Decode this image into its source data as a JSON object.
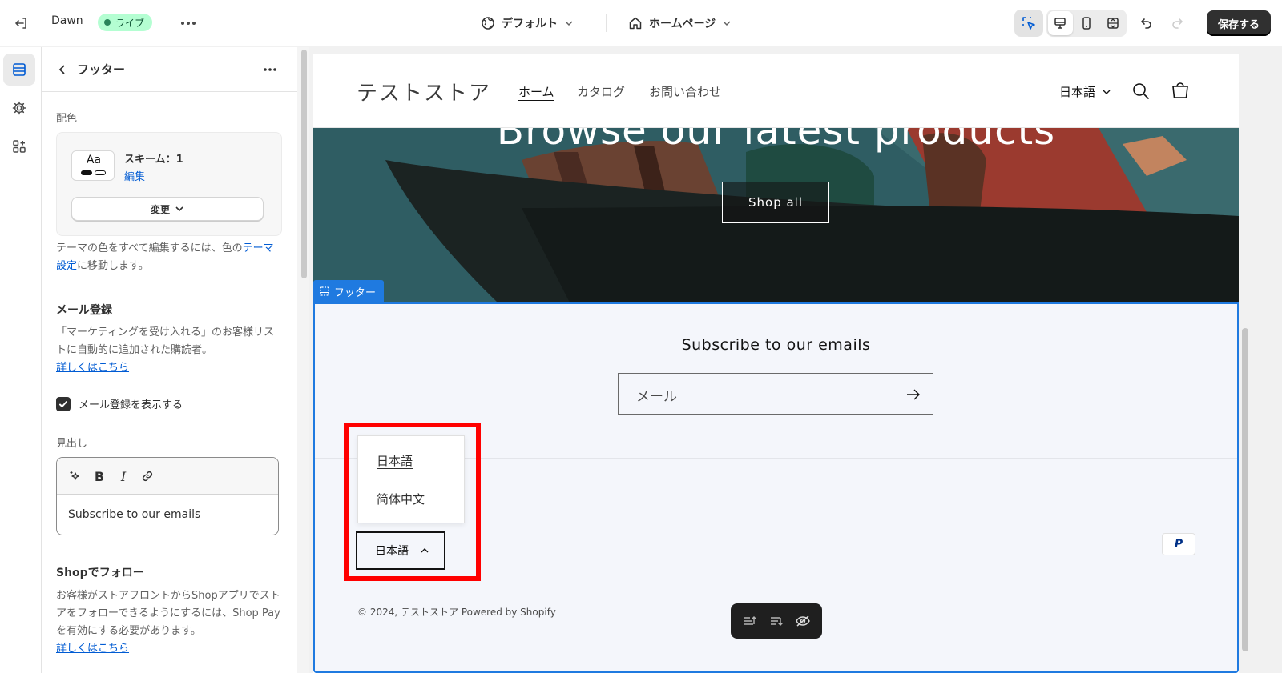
{
  "topbar": {
    "theme_name": "Dawn",
    "status_badge": "ライブ",
    "preset_label": "デフォルト",
    "page_label": "ホームページ",
    "save_label": "保存する"
  },
  "panel": {
    "title": "フッター",
    "color_section_label": "配色",
    "scheme": {
      "swatch_text": "Aa",
      "name": "スキーム：1",
      "edit_label": "編集",
      "change_label": "変更"
    },
    "color_help_prefix": "テーマの色をすべて編集するには、色の",
    "color_help_link": "テーマ設定",
    "color_help_suffix": "に移動します。",
    "email_section_title": "メール登録",
    "email_help": "「マーケティングを受け入れる」のお客様リストに自動的に追加された購読者。",
    "email_help_link": "詳しくはこちら",
    "show_email_label": "メール登録を表示する",
    "show_email_checked": true,
    "heading_label": "見出し",
    "heading_value": "Subscribe to our emails",
    "shop_follow_title": "Shopでフォロー",
    "shop_follow_help": "お客様がストアフロントからShopアプリでストアをフォローできるようにするには、Shop Payを有効にする必要があります。",
    "shop_follow_link": "詳しくはこちら"
  },
  "preview": {
    "store_name": "テストストア",
    "nav": [
      "ホーム",
      "カタログ",
      "お問い合わせ"
    ],
    "header_language": "日本語",
    "hero_title": "Browse our latest products",
    "hero_button": "Shop all",
    "section_tag": "フッター",
    "subscribe_title": "Subscribe to our emails",
    "email_placeholder": "メール",
    "language_options": [
      "日本語",
      "简体中文"
    ],
    "selected_language": "日本語",
    "payment_icon": "P",
    "copyright_prefix": "© 2024, テストストア",
    "copyright_suffix": "Powered by Shopify"
  },
  "colors": {
    "accent": "#005bd3",
    "selection": "#1f7ae0",
    "highlight_box": "#ff0000",
    "live_badge_bg": "#b4fed2",
    "save_button": "#303030"
  }
}
